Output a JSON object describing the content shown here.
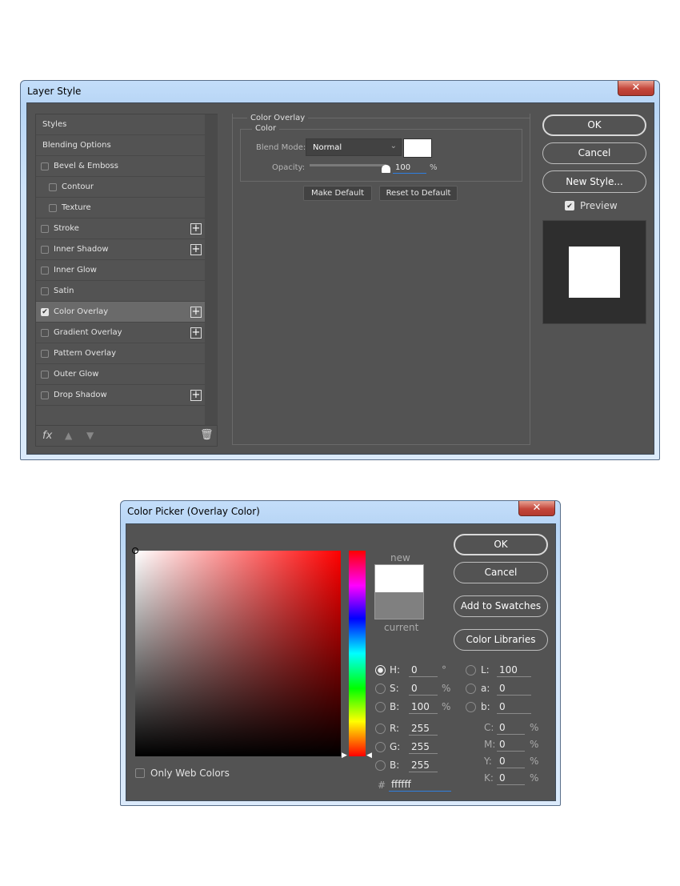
{
  "layer_style": {
    "title": "Layer Style",
    "close": "✕",
    "list": [
      {
        "label": "Styles",
        "checkbox": false,
        "indent": 0,
        "plus": false,
        "checked": false
      },
      {
        "label": "Blending Options",
        "checkbox": false,
        "indent": 0,
        "plus": false,
        "checked": false
      },
      {
        "label": "Bevel & Emboss",
        "checkbox": true,
        "indent": 0,
        "plus": false,
        "checked": false
      },
      {
        "label": "Contour",
        "checkbox": true,
        "indent": 1,
        "plus": false,
        "checked": false
      },
      {
        "label": "Texture",
        "checkbox": true,
        "indent": 1,
        "plus": false,
        "checked": false
      },
      {
        "label": "Stroke",
        "checkbox": true,
        "indent": 0,
        "plus": true,
        "checked": false
      },
      {
        "label": "Inner Shadow",
        "checkbox": true,
        "indent": 0,
        "plus": true,
        "checked": false
      },
      {
        "label": "Inner Glow",
        "checkbox": true,
        "indent": 0,
        "plus": false,
        "checked": false
      },
      {
        "label": "Satin",
        "checkbox": true,
        "indent": 0,
        "plus": false,
        "checked": false
      },
      {
        "label": "Color Overlay",
        "checkbox": true,
        "indent": 0,
        "plus": true,
        "checked": true,
        "selected": true
      },
      {
        "label": "Gradient Overlay",
        "checkbox": true,
        "indent": 0,
        "plus": true,
        "checked": false
      },
      {
        "label": "Pattern Overlay",
        "checkbox": true,
        "indent": 0,
        "plus": false,
        "checked": false
      },
      {
        "label": "Outer Glow",
        "checkbox": true,
        "indent": 0,
        "plus": false,
        "checked": false
      },
      {
        "label": "Drop Shadow",
        "checkbox": true,
        "indent": 0,
        "plus": true,
        "checked": false
      }
    ],
    "fx": "fx",
    "panel": {
      "group": "Color Overlay",
      "subgroup": "Color",
      "blend_label": "Blend Mode:",
      "blend_value": "Normal",
      "swatch_color": "#ffffff",
      "opacity_label": "Opacity:",
      "opacity_value": "100",
      "opacity_unit": "%",
      "opacity_percent": 100,
      "make_default": "Make Default",
      "reset_default": "Reset to Default"
    },
    "buttons": {
      "ok": "OK",
      "cancel": "Cancel",
      "new_style": "New Style...",
      "preview": "Preview",
      "preview_checked": true
    }
  },
  "color_picker": {
    "title": "Color Picker (Overlay Color)",
    "close": "✕",
    "new_label": "new",
    "current_label": "current",
    "new_color": "#ffffff",
    "current_color": "#808080",
    "ok": "OK",
    "cancel": "Cancel",
    "add_swatches": "Add to Swatches",
    "color_libraries": "Color Libraries",
    "only_web": "Only Web Colors",
    "hsb": [
      {
        "label": "H:",
        "value": "0",
        "unit": "°",
        "selected": true
      },
      {
        "label": "S:",
        "value": "0",
        "unit": "%"
      },
      {
        "label": "B:",
        "value": "100",
        "unit": "%"
      }
    ],
    "rgb": [
      {
        "label": "R:",
        "value": "255"
      },
      {
        "label": "G:",
        "value": "255"
      },
      {
        "label": "B:",
        "value": "255"
      }
    ],
    "lab": [
      {
        "label": "L:",
        "value": "100"
      },
      {
        "label": "a:",
        "value": "0"
      },
      {
        "label": "b:",
        "value": "0"
      }
    ],
    "cmyk": [
      {
        "label": "C:",
        "value": "0",
        "unit": "%"
      },
      {
        "label": "M:",
        "value": "0",
        "unit": "%"
      },
      {
        "label": "Y:",
        "value": "0",
        "unit": "%"
      },
      {
        "label": "K:",
        "value": "0",
        "unit": "%"
      }
    ],
    "hex_label": "#",
    "hex": "ffffff"
  }
}
